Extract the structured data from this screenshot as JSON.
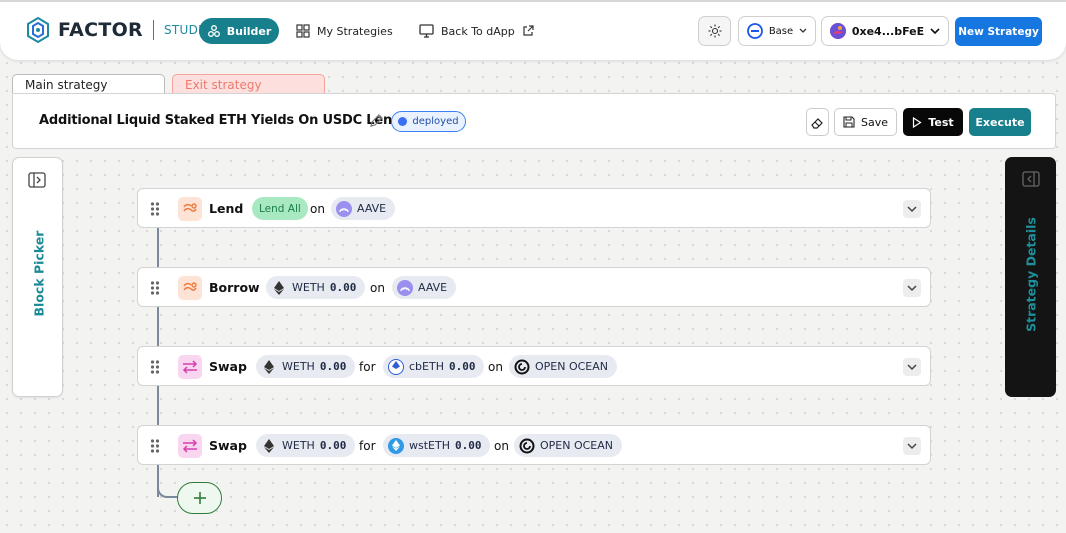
{
  "nav": {
    "brand": "FACTOR",
    "studio": "STUDIO",
    "builder": "Builder",
    "my_strategies": "My Strategies",
    "back_to_dapp": "Back To dApp",
    "network": "Base",
    "wallet": "0xe4...bFeE",
    "new_strategy": "New Strategy"
  },
  "tabs": {
    "main": "Main strategy",
    "exit": "Exit strategy"
  },
  "header": {
    "title": "Additional Liquid Staked ETH Yields On USDC Lend",
    "status": "deployed",
    "save": "Save",
    "test": "Test",
    "execute": "Execute"
  },
  "side": {
    "block_picker": "Block Picker",
    "strategy_details": "Strategy Details"
  },
  "blocks": [
    {
      "name": "Lend",
      "tag": "Lend All",
      "on": "on",
      "protocol": "AAVE"
    },
    {
      "name": "Borrow",
      "token": "WETH",
      "amount": "0.00",
      "on": "on",
      "protocol": "AAVE"
    },
    {
      "name": "Swap",
      "token": "WETH",
      "amount": "0.00",
      "for": "for",
      "token2": "cbETH",
      "amount2": "0.00",
      "on": "on",
      "protocol": "OPEN OCEAN"
    },
    {
      "name": "Swap",
      "token": "WETH",
      "amount": "0.00",
      "for": "for",
      "token2": "wstETH",
      "amount2": "0.00",
      "on": "on",
      "protocol": "OPEN OCEAN"
    }
  ],
  "colors": {
    "teal": "#187f8c",
    "blue": "#1777e0",
    "deployed_blue": "#3b6ff3",
    "exit_red": "#ea7a70"
  }
}
